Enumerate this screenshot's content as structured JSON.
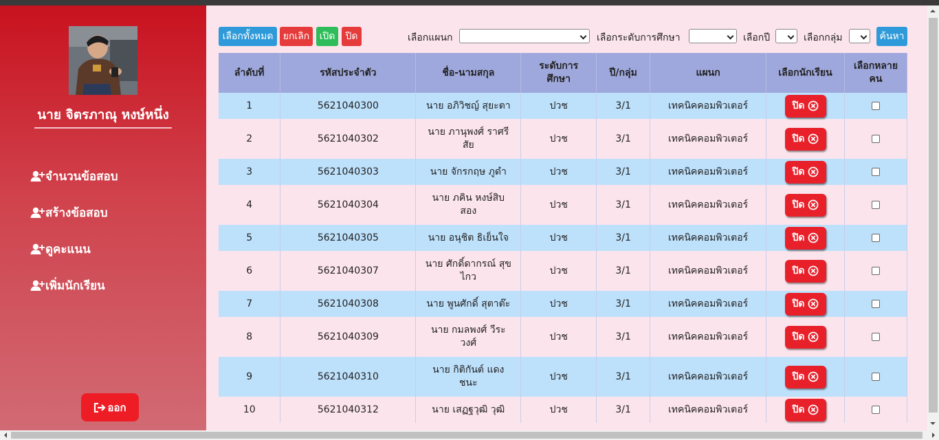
{
  "sidebar": {
    "user_name": "นาย จิตรภาณุ หงษ์หนึ่ง",
    "menu": [
      {
        "label": "จำนวนข้อสอบ"
      },
      {
        "label": "สร้างข้อสอบ"
      },
      {
        "label": "ดูคะแนน"
      },
      {
        "label": "เพิ่มนักเรียน"
      }
    ],
    "logout_label": "ออก"
  },
  "toolbar": {
    "select_all": "เลือกทั้งหมด",
    "cancel": "ยกเลิก",
    "open": "เปิด",
    "close": "ปิด",
    "dept_label": "เลือกแผนก",
    "level_label": "เลือกระดับการศึกษา",
    "year_label": "เลือกปี",
    "group_label": "เลือกกลุ่ม",
    "search": "ค้นหา"
  },
  "table": {
    "headers": [
      "ลำดับที่",
      "รหัสประจำตัว",
      "ชื่อ-นามสกุล",
      "ระดับการ\nศึกษา",
      "ปี/กลุ่ม",
      "แผนก",
      "เลือกนักเรียน",
      "เลือกหลาย\nคน"
    ],
    "button_label": "ปิด",
    "rows": [
      {
        "no": "1",
        "id": "5621040300",
        "name": "นาย อภิวิชญ์ สุยะตา",
        "level": "ปวช",
        "yg": "3/1",
        "dept": "เทคนิคคอมพิวเตอร์"
      },
      {
        "no": "2",
        "id": "5621040302",
        "name": "นาย ภานุพงศ์ ราศรี\nสัย",
        "level": "ปวช",
        "yg": "3/1",
        "dept": "เทคนิคคอมพิวเตอร์"
      },
      {
        "no": "3",
        "id": "5621040303",
        "name": "นาย จักรกฤษ ภูดำ",
        "level": "ปวช",
        "yg": "3/1",
        "dept": "เทคนิคคอมพิวเตอร์"
      },
      {
        "no": "4",
        "id": "5621040304",
        "name": "นาย ภคิน หงษ์สิบ\nสอง",
        "level": "ปวช",
        "yg": "3/1",
        "dept": "เทคนิคคอมพิวเตอร์"
      },
      {
        "no": "5",
        "id": "5621040305",
        "name": "นาย อนุชิต ธิเย็นใจ",
        "level": "ปวช",
        "yg": "3/1",
        "dept": "เทคนิคคอมพิวเตอร์"
      },
      {
        "no": "6",
        "id": "5621040307",
        "name": "นาย ศักดิ์ดากรณ์ สุข\nไกว",
        "level": "ปวช",
        "yg": "3/1",
        "dept": "เทคนิคคอมพิวเตอร์"
      },
      {
        "no": "7",
        "id": "5621040308",
        "name": "นาย พูนศักดิ์ สุตาต๊ะ",
        "level": "ปวช",
        "yg": "3/1",
        "dept": "เทคนิคคอมพิวเตอร์"
      },
      {
        "no": "8",
        "id": "5621040309",
        "name": "นาย กมลพงศ์ วีระ\nวงศ์",
        "level": "ปวช",
        "yg": "3/1",
        "dept": "เทคนิคคอมพิวเตอร์"
      },
      {
        "no": "9",
        "id": "5621040310",
        "name": "นาย กิติกันต์ แดง\nชนะ",
        "level": "ปวช",
        "yg": "3/1",
        "dept": "เทคนิคคอมพิวเตอร์"
      },
      {
        "no": "10",
        "id": "5621040312",
        "name": "นาย เสฏฐวุฒิ วุฒิ",
        "level": "ปวช",
        "yg": "3/1",
        "dept": "เทคนิคคอมพิวเตอร์"
      }
    ]
  }
}
